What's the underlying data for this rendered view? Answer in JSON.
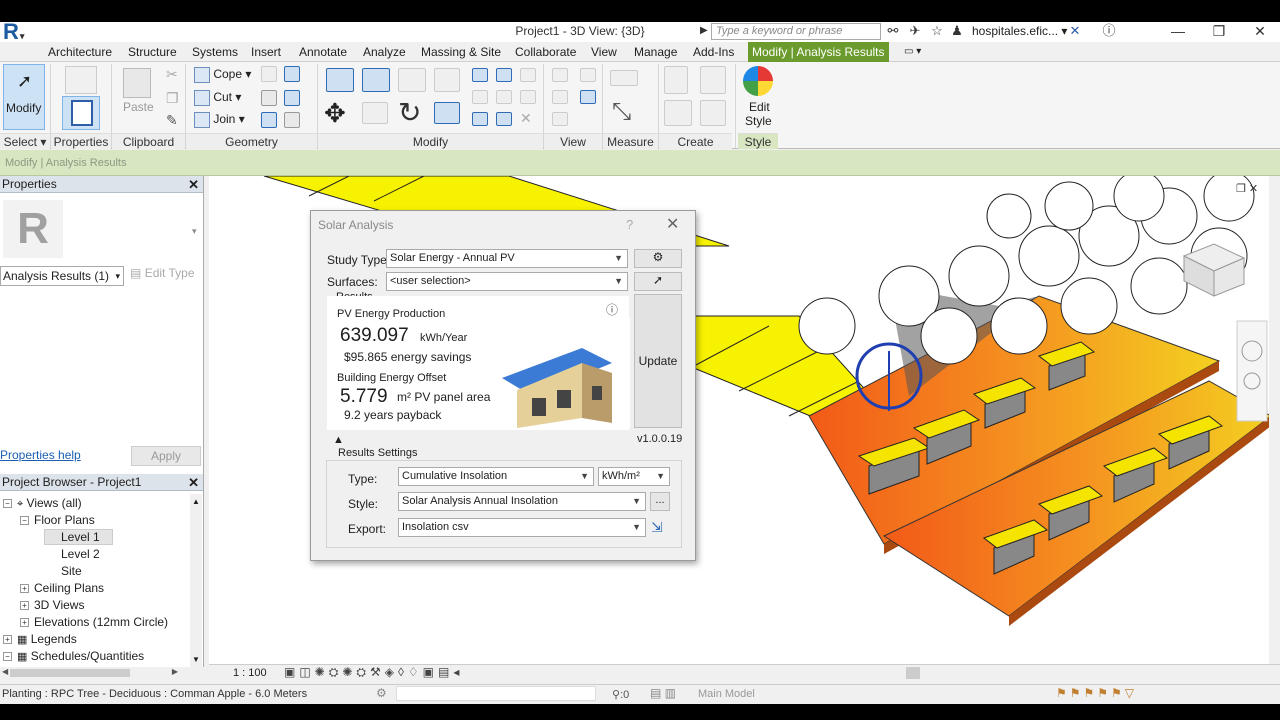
{
  "titlebar": {
    "logo": "R",
    "project_title": "Project1 - 3D View: {3D}",
    "search_placeholder": "Type a keyword or phrase",
    "user": "hospitales.efic..."
  },
  "tabs": [
    "Architecture",
    "Structure",
    "Systems",
    "Insert",
    "Annotate",
    "Analyze",
    "Massing & Site",
    "Collaborate",
    "View",
    "Manage",
    "Add-Ins"
  ],
  "active_tab": "Modify | Analysis Results",
  "ribbon": {
    "modify": "Modify",
    "paste": "Paste",
    "cope": "Cope",
    "cut": "Cut",
    "join": "Join",
    "edit_style_1": "Edit",
    "edit_style_2": "Style",
    "panels": {
      "select": "Select",
      "properties": "Properties",
      "clipboard": "Clipboard",
      "geometry": "Geometry",
      "modify": "Modify",
      "view": "View",
      "measure": "Measure",
      "create": "Create",
      "style": "Style"
    }
  },
  "context_bar": "Modify | Analysis Results",
  "properties": {
    "title": "Properties",
    "type_selector": "Analysis Results (1)",
    "edit_type": "Edit Type",
    "help": "Properties help",
    "apply": "Apply"
  },
  "browser": {
    "title": "Project Browser - Project1",
    "items": {
      "views": "Views (all)",
      "floor_plans": "Floor Plans",
      "level1": "Level 1",
      "level2": "Level 2",
      "site": "Site",
      "ceiling": "Ceiling Plans",
      "views3d": "3D Views",
      "elevations": "Elevations (12mm Circle)",
      "legends": "Legends",
      "schedules": "Schedules/Quantities"
    }
  },
  "dialog": {
    "title": "Solar Analysis",
    "study_type_label": "Study Type:",
    "study_type": "Solar Energy - Annual PV",
    "surfaces_label": "Surfaces:",
    "surfaces": "<user selection>",
    "results_label": "Results",
    "pv_heading": "PV Energy Production",
    "pv_value": "639.097",
    "pv_unit": "kWh/Year",
    "savings": "$95.865 energy savings",
    "offset_heading": "Building Energy Offset",
    "area_value": "5.779",
    "area_unit": "m² PV panel area",
    "payback": "9.2 years payback",
    "update": "Update",
    "version": "v1.0.0.19",
    "settings_label": "Results Settings",
    "type_label": "Type:",
    "type_value": "Cumulative Insolation",
    "unit_value": "kWh/m²",
    "style_label": "Style:",
    "style_value": "Solar Analysis Annual Insolation",
    "export_label": "Export:",
    "export_value": "Insolation csv",
    "dots": "..."
  },
  "status": {
    "scale": "1 : 100",
    "text": "Planting : RPC Tree - Deciduous : Comman Apple - 6.0 Meters",
    "count": ":0",
    "model": "Main Model"
  },
  "colors": {
    "active_tab": "#6b9b2c",
    "context_bar": "#d8e6c2",
    "surface_yellow": "#f7f200",
    "heat_orange": "#f57a20",
    "selection_blue": "#1f3fb0"
  }
}
